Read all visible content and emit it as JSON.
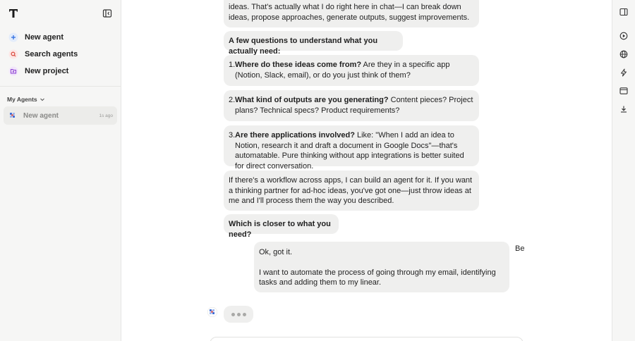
{
  "sidebar": {
    "new_agent": "New agent",
    "search_agents": "Search agents",
    "new_project": "New project",
    "section_label": "My Agents",
    "agents": [
      {
        "name": "New agent",
        "time": "1s ago"
      }
    ]
  },
  "chat": {
    "messages": [
      {
        "role": "assistant",
        "text": "ideas. That's actually what I do right here in chat—I can break down ideas, propose approaches, generate outputs, suggest improvements."
      },
      {
        "role": "assistant",
        "bold": "A few questions to understand what you actually need:"
      },
      {
        "role": "assistant",
        "num": "1.",
        "bold": "Where do these ideas come from?",
        "text": " Are they in a specific app (Notion, Slack, email), or do you just think of them?"
      },
      {
        "role": "assistant",
        "num": "2.",
        "bold": "What kind of outputs are you generating?",
        "text": " Content pieces? Project plans? Technical specs? Product requirements?"
      },
      {
        "role": "assistant",
        "num": "3.",
        "bold": "Are there applications involved?",
        "text": " Like: \"When I add an idea to Notion, research it and draft a document in Google Docs\"—that's automatable. Pure thinking without app integrations is better suited for direct conversation."
      },
      {
        "role": "assistant",
        "text": "If there's a workflow across apps, I can build an agent for it. If you want a thinking partner for ad-hoc ideas, you've got one—just throw ideas at me and I'll process them the way you described."
      },
      {
        "role": "assistant",
        "bold": "Which is closer to what you need?"
      },
      {
        "role": "user",
        "author": "Be",
        "line1": "Ok, got it.",
        "line2": "I want to automate the process of going through my email, identifying tasks and adding them to my linear."
      }
    ]
  }
}
